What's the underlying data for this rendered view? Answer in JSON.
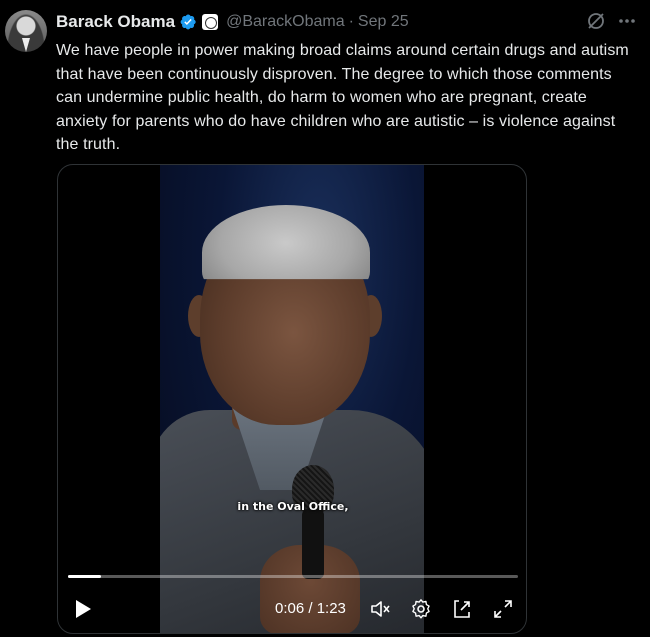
{
  "author": {
    "name": "Barack Obama",
    "handle": "@BarackObama",
    "separator": "·",
    "date": "Sep 25",
    "verified_icon": "verified-badge-icon",
    "affiliation_icon": "government-seal-icon"
  },
  "actions": {
    "grok_icon": "grok-icon",
    "more_icon": "more-options-icon"
  },
  "tweet": {
    "text": "We have people in power making broad claims around certain drugs and autism that have been continuously disproven. The degree to which those comments can undermine public health, do harm to women who are pregnant, create anxiety for parents who do have children who are autistic – is violence against the truth."
  },
  "video": {
    "caption": "in the Oval Office,",
    "time": "0:06 / 1:23",
    "progress": 0.073,
    "icons": [
      "play-icon",
      "mute-icon",
      "settings-icon",
      "picture-in-picture-icon",
      "fullscreen-icon"
    ]
  },
  "colors": {
    "background": "#000000",
    "text": "#e7e9ea",
    "secondary": "#71767b",
    "verified": "#1d9bf0",
    "border": "#2f3336"
  }
}
